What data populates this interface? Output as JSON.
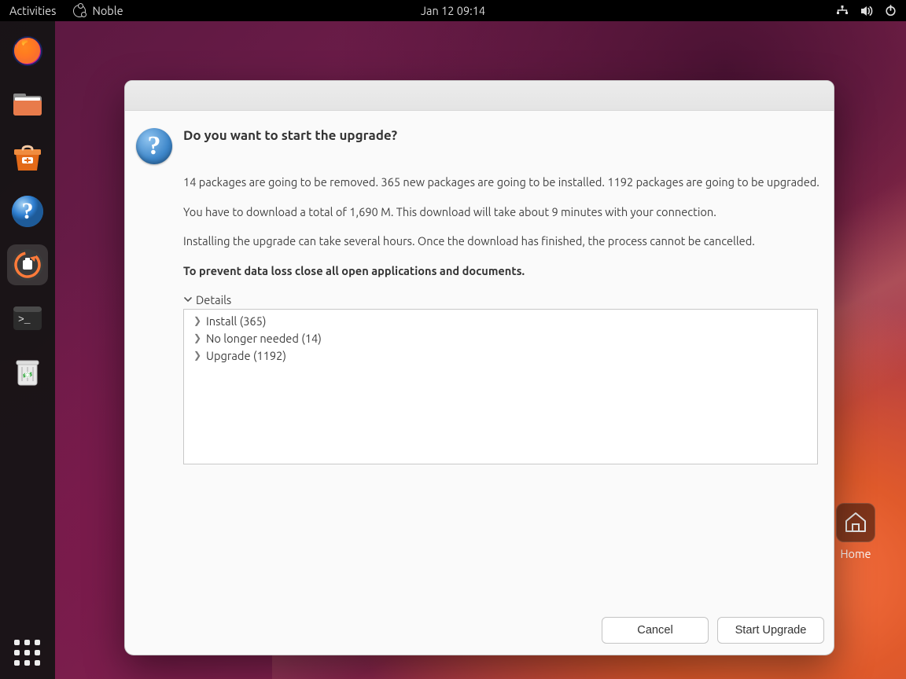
{
  "topbar": {
    "activities": "Activities",
    "app_name": "Noble",
    "clock": "Jan 12  09:14"
  },
  "desktop": {
    "home_label": "Home"
  },
  "dock": {
    "items": [
      {
        "name": "firefox"
      },
      {
        "name": "files"
      },
      {
        "name": "software"
      },
      {
        "name": "help"
      },
      {
        "name": "software-updater"
      },
      {
        "name": "terminal"
      },
      {
        "name": "trash"
      }
    ]
  },
  "dialog": {
    "title": "Do you want to start the upgrade?",
    "line1": "14 packages are going to be removed. 365 new packages are going to be installed. 1192 packages are going to be upgraded.",
    "line2": "You have to download a total of 1,690 M. This download will take about 9 minutes with your connection.",
    "line3": "Installing the upgrade can take several hours. Once the download has finished, the process cannot be cancelled.",
    "warn": "To prevent data loss close all open applications and documents.",
    "details_label": "Details",
    "tree": [
      {
        "label": "Install (365)"
      },
      {
        "label": "No longer needed (14)"
      },
      {
        "label": "Upgrade (1192)"
      }
    ],
    "cancel": "Cancel",
    "start": "Start Upgrade"
  }
}
